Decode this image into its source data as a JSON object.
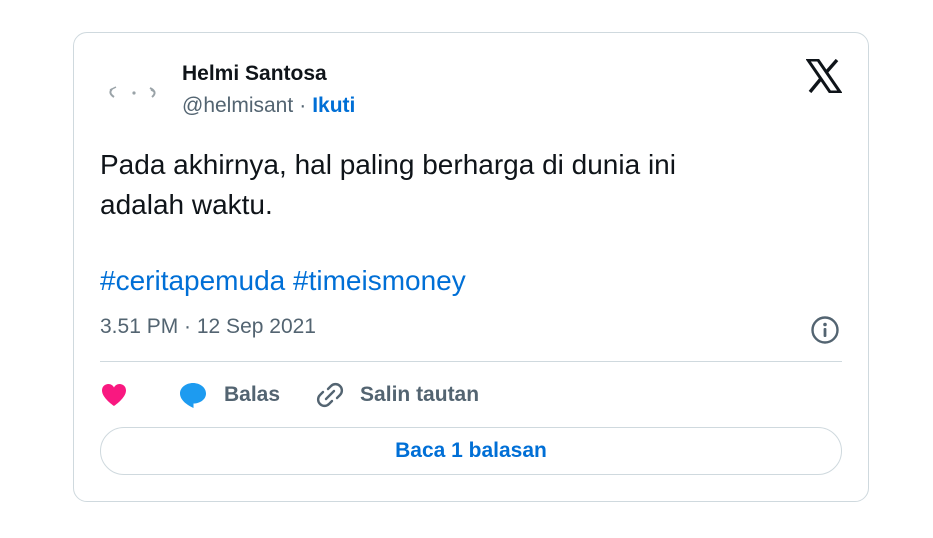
{
  "tweet": {
    "author": {
      "display_name": "Helmi Santosa",
      "handle": "@helmisant",
      "separator": "·",
      "follow_label": "Ikuti",
      "avatar_icon": "avatar-image"
    },
    "brand_icon": "x-logo-icon",
    "text_lines": [
      "Pada akhirnya, hal paling berharga di dunia ini",
      "adalah waktu."
    ],
    "hashtags": [
      "#ceritapemuda",
      "#timeismoney"
    ],
    "timestamp": "3.51 PM · 12 Sep 2021",
    "info_icon": "info-icon",
    "actions": {
      "like_icon": "heart-icon",
      "reply_icon": "speech-bubble-icon",
      "reply_label": "Balas",
      "copy_icon": "link-icon",
      "copy_label": "Salin tautan"
    },
    "read_replies_label": "Baca 1 balasan"
  },
  "colors": {
    "text": "#0f1419",
    "secondary": "#536471",
    "link": "#006fd6",
    "border": "#cfd9de",
    "heart": "#f91880",
    "reply_bubble": "#1d9bf0"
  }
}
